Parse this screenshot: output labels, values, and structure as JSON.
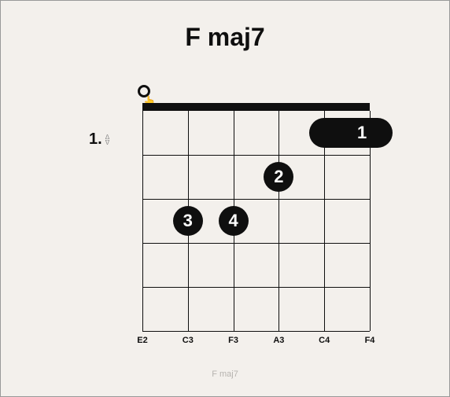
{
  "chord": {
    "name": "F maj7",
    "footer_label": "F maj7"
  },
  "fret_position": {
    "label": "1."
  },
  "strings": {
    "count": 6,
    "tuning": [
      "E2",
      "C3",
      "F3",
      "A3",
      "C4",
      "F4"
    ]
  },
  "frets": {
    "count": 5
  },
  "fingers": [
    {
      "type": "barre",
      "fret": 1,
      "from_string": 5,
      "to_string": 6,
      "finger": "1"
    },
    {
      "type": "dot",
      "fret": 2,
      "string": 4,
      "finger": "2"
    },
    {
      "type": "dot",
      "fret": 3,
      "string": 2,
      "finger": "3"
    },
    {
      "type": "dot",
      "fret": 3,
      "string": 3,
      "finger": "4"
    }
  ],
  "open_markers": [
    {
      "string": 1
    }
  ]
}
